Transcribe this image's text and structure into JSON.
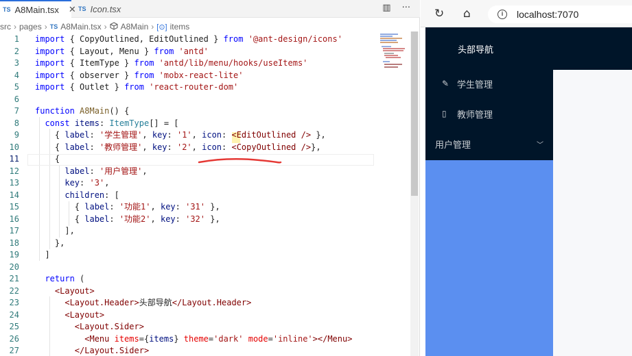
{
  "editor": {
    "tabs": [
      {
        "badge": "TS",
        "name": "A8Main.tsx",
        "close": "✕"
      },
      {
        "badge": "TS",
        "name": "Icon.tsx"
      }
    ],
    "tab_actions": {
      "split": "▥",
      "more": "···"
    },
    "breadcrumb": {
      "items": [
        "src",
        "pages",
        "A8Main.tsx",
        "A8Main",
        "items"
      ],
      "badge": "TS",
      "brace": "[⊙]"
    },
    "lines": [
      {
        "n": "1",
        "html": "<span class='kw'>import</span> { CopyOutlined, EditOutlined } <span class='kw'>from</span> <span class='str'>'@ant-design/icons'</span>"
      },
      {
        "n": "2",
        "html": "<span class='kw'>import</span> { Layout, Menu } <span class='kw'>from</span> <span class='str'>'antd'</span>"
      },
      {
        "n": "3",
        "html": "<span class='kw'>import</span> { ItemType } <span class='kw'>from</span> <span class='str'>'antd/lib/menu/hooks/useItems'</span>"
      },
      {
        "n": "4",
        "html": "<span class='kw'>import</span> { observer } <span class='kw'>from</span> <span class='str'>'mobx-react-lite'</span>"
      },
      {
        "n": "5",
        "html": "<span class='kw'>import</span> { Outlet } <span class='kw'>from</span> <span class='str'>'react-router-dom'</span>"
      },
      {
        "n": "6",
        "html": ""
      },
      {
        "n": "7",
        "html": "<span class='kw'>function</span> <span class='fn'>A8Main</span>() {"
      },
      {
        "n": "8",
        "html": "  <span class='kw'>const</span> <span class='var'>items</span>: <span class='ty'>ItemType</span>[] = ["
      },
      {
        "n": "9",
        "html": "    { <span class='var'>label</span>: <span class='str'>'学生管理'</span>, <span class='var'>key</span>: <span class='str'>'1'</span>, <span class='var'>icon</span>: <span class='tag'>&lt;EditOutlined</span> <span class='tag'>/&gt;</span> },"
      },
      {
        "n": "10",
        "html": "    { <span class='var'>label</span>: <span class='str'>'教师管理'</span>, <span class='var'>key</span>: <span class='str'>'2'</span>, <span class='var'>icon</span>: <span class='tag'>&lt;CopyOutlined</span> <span class='tag'>/&gt;</span>},"
      },
      {
        "n": "11",
        "html": "    {"
      },
      {
        "n": "12",
        "html": "      <span class='var'>label</span>: <span class='str'>'用户管理'</span>,"
      },
      {
        "n": "13",
        "html": "      <span class='var'>key</span>: <span class='str'>'3'</span>,"
      },
      {
        "n": "14",
        "html": "      <span class='var'>children</span>: ["
      },
      {
        "n": "15",
        "html": "        { <span class='var'>label</span>: <span class='str'>'功能1'</span>, <span class='var'>key</span>: <span class='str'>'31'</span> },"
      },
      {
        "n": "16",
        "html": "        { <span class='var'>label</span>: <span class='str'>'功能2'</span>, <span class='var'>key</span>: <span class='str'>'32'</span> },"
      },
      {
        "n": "17",
        "html": "      ],"
      },
      {
        "n": "18",
        "html": "    },"
      },
      {
        "n": "19",
        "html": "  ]"
      },
      {
        "n": "20",
        "html": ""
      },
      {
        "n": "21",
        "html": "  <span class='kw'>return</span> ("
      },
      {
        "n": "22",
        "html": "    <span class='tag'>&lt;Layout&gt;</span>"
      },
      {
        "n": "23",
        "html": "      <span class='tag'>&lt;Layout.Header&gt;</span>头部导航<span class='tag'>&lt;/Layout.Header&gt;</span>"
      },
      {
        "n": "24",
        "html": "      <span class='tag'>&lt;Layout&gt;</span>"
      },
      {
        "n": "25",
        "html": "        <span class='tag'>&lt;Layout.Sider&gt;</span>"
      },
      {
        "n": "26",
        "html": "          <span class='tag'>&lt;Menu</span> <span class='attr'>items</span>={<span class='var'>items</span>} <span class='attr'>theme</span>=<span class='str'>'dark'</span> <span class='attr'>mode</span>=<span class='str'>'inline'</span><span class='tag'>&gt;&lt;/Menu&gt;</span>"
      },
      {
        "n": "27",
        "html": "        <span class='tag'>&lt;/Layout.Sider&gt;</span>"
      }
    ],
    "current_line": "11"
  },
  "browser": {
    "nav": {
      "reload": "↻",
      "home": "⌂"
    },
    "address": {
      "info": "i",
      "url": "localhost:7070"
    },
    "app": {
      "header_title": "头部导航",
      "menu": [
        {
          "icon": "edit-icon",
          "glyph": "✎",
          "label": "学生管理"
        },
        {
          "icon": "copy-icon",
          "glyph": "▯",
          "label": "教师管理"
        },
        {
          "label": "用户管理",
          "chevron": "﹀"
        }
      ]
    }
  },
  "colors": {
    "sider": "#001529",
    "sider_fill": "#5b8ff0",
    "annotation": "#e53935"
  }
}
